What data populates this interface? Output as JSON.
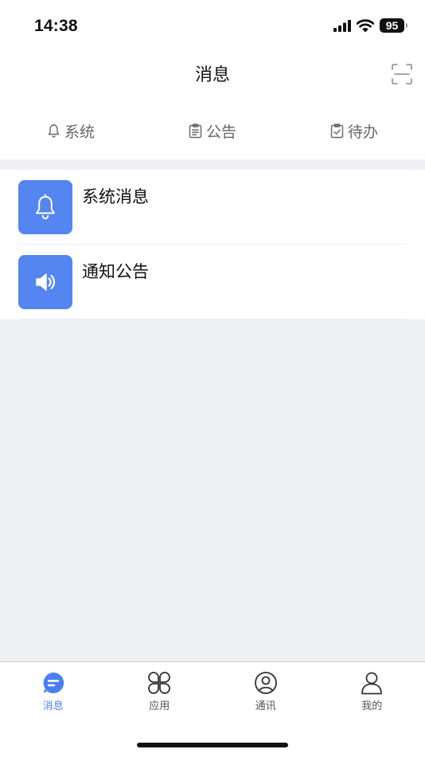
{
  "status_bar": {
    "time": "14:38",
    "battery": "95"
  },
  "header": {
    "title": "消息"
  },
  "tabs": [
    {
      "label": "系统",
      "icon": "bell-icon"
    },
    {
      "label": "公告",
      "icon": "clipboard-icon"
    },
    {
      "label": "待办",
      "icon": "clipboard-check-icon"
    }
  ],
  "list": [
    {
      "label": "系统消息",
      "icon": "bell-icon"
    },
    {
      "label": "通知公告",
      "icon": "speaker-icon"
    }
  ],
  "tabbar": [
    {
      "label": "消息",
      "icon": "chat-icon",
      "active": true
    },
    {
      "label": "应用",
      "icon": "apps-icon"
    },
    {
      "label": "通讯",
      "icon": "contact-icon"
    },
    {
      "label": "我的",
      "icon": "user-icon"
    }
  ],
  "colors": {
    "accent": "#4a7ff0",
    "icon_bg": "#5585f0",
    "background": "#eff0f4"
  }
}
